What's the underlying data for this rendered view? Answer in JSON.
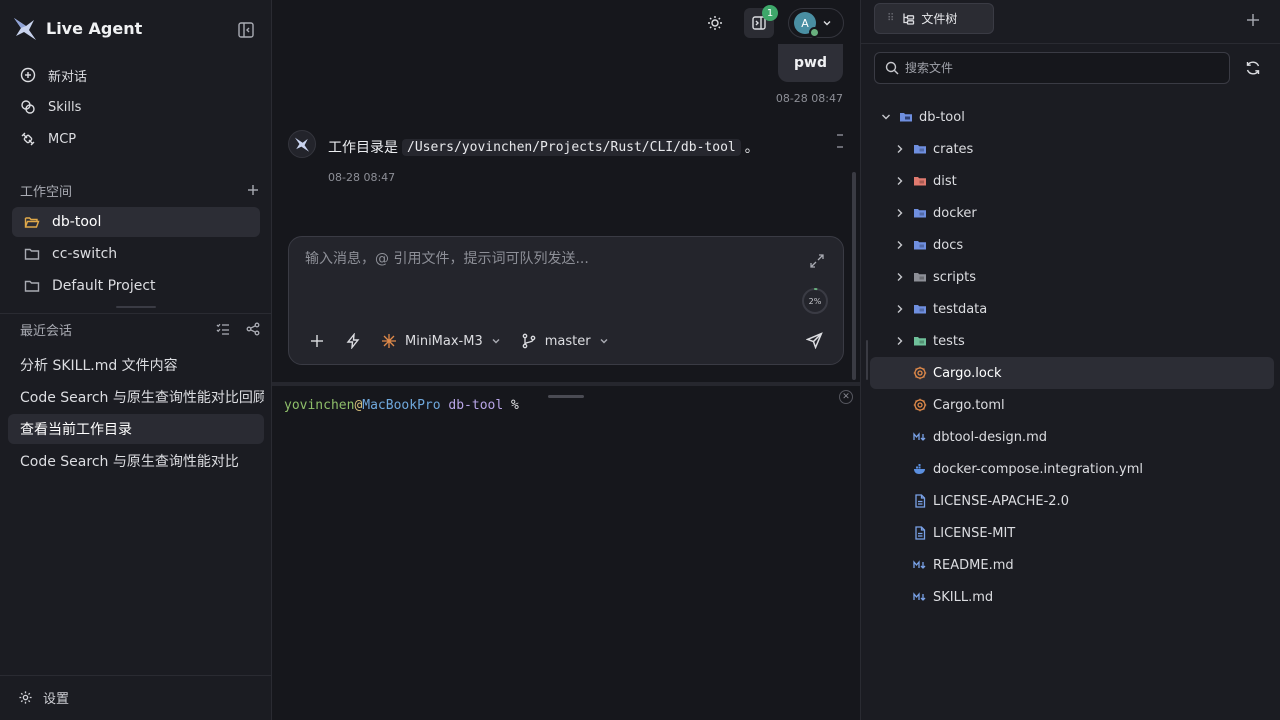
{
  "sidebar": {
    "brand": "Live Agent",
    "nav": [
      {
        "label": "新对话",
        "icon": "plus-circle-icon"
      },
      {
        "label": "Skills",
        "icon": "skills-icon"
      },
      {
        "label": "MCP",
        "icon": "mcp-plug-icon"
      }
    ],
    "workspace_title": "工作空间",
    "workspaces": [
      {
        "label": "db-tool",
        "active": true
      },
      {
        "label": "cc-switch",
        "active": false
      },
      {
        "label": "Default Project",
        "active": false
      }
    ],
    "recent_title": "最近会话",
    "recent": [
      {
        "label": "分析 SKILL.md 文件内容",
        "active": false
      },
      {
        "label": "Code Search 与原生查询性能对比回顾",
        "active": false
      },
      {
        "label": "查看当前工作目录",
        "active": true
      },
      {
        "label": "Code Search 与原生查询性能对比",
        "active": false
      }
    ],
    "settings_label": "设置"
  },
  "main": {
    "notification_count": "1",
    "avatar_letter": "A",
    "user_message": "pwd",
    "user_time": "08-28 08:47",
    "bot_message_prefix": "工作目录是",
    "bot_message_path": "/Users/yovinchen/Projects/Rust/CLI/db-tool",
    "bot_message_suffix": "。",
    "bot_time": "08-28 08:47",
    "composer": {
      "placeholder": "输入消息，@ 引用文件，提示词可队列发送...",
      "context_usage": "2%",
      "context_fraction": 0.02,
      "model": "MiniMax-M3",
      "branch": "master"
    },
    "terminal": {
      "user": "yovinchen",
      "at": "@",
      "host": "MacBookPro",
      "dir": "db-tool",
      "prompt": "%"
    }
  },
  "files": {
    "tab_label": "文件树",
    "search_placeholder": "搜索文件",
    "root": "db-tool",
    "folders": [
      {
        "name": "crates",
        "color": "#6f8fe0"
      },
      {
        "name": "dist",
        "color": "#e07a6f"
      },
      {
        "name": "docker",
        "color": "#6f8fe0"
      },
      {
        "name": "docs",
        "color": "#6f8fe0"
      },
      {
        "name": "scripts",
        "color": "#8d8f97"
      },
      {
        "name": "testdata",
        "color": "#6f8fe0"
      },
      {
        "name": "tests",
        "color": "#6fc09a"
      }
    ],
    "files": [
      {
        "name": "Cargo.lock",
        "icon": "rust-icon",
        "active": true
      },
      {
        "name": "Cargo.toml",
        "icon": "rust-icon",
        "active": false
      },
      {
        "name": "dbtool-design.md",
        "icon": "markdown-icon",
        "active": false
      },
      {
        "name": "docker-compose.integration.yml",
        "icon": "docker-icon",
        "active": false
      },
      {
        "name": "LICENSE-APACHE-2.0",
        "icon": "document-icon",
        "active": false
      },
      {
        "name": "LICENSE-MIT",
        "icon": "document-icon",
        "active": false
      },
      {
        "name": "README.md",
        "icon": "markdown-icon",
        "active": false
      },
      {
        "name": "SKILL.md",
        "icon": "markdown-icon",
        "active": false
      }
    ]
  }
}
